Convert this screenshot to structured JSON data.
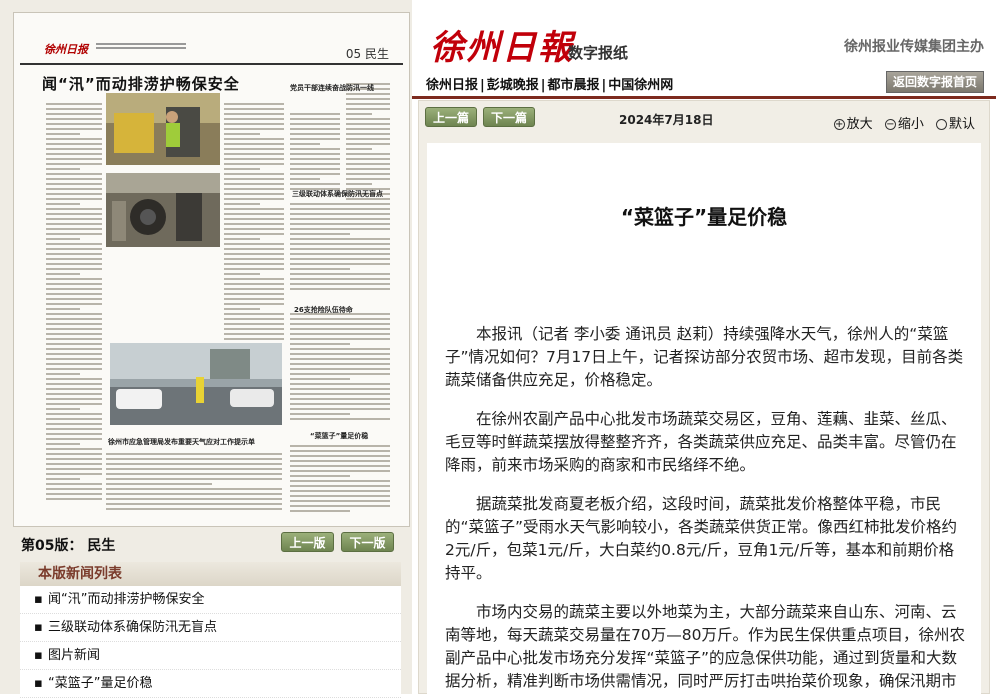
{
  "colors": {
    "brand_red": "#c1000a",
    "nav_rule": "#7d2a1e",
    "button_green": "#7a9158",
    "list_header_text": "#7a3b2b",
    "panel_bg": "#f1eee6"
  },
  "thumbnail": {
    "logo": "徐州日报",
    "page_label": "05 民生",
    "headline": "闻“汛”而动排涝护畅保安全",
    "heads": [
      "党员干部连续奋战防汛一线",
      "三级联动体系确保防汛无盲点",
      "26支抢险队伍待命",
      "徐州市应急管理局发布重要天气应对工作提示单",
      "“菜篮子”量足价稳"
    ]
  },
  "edition": {
    "label": "第05版： 民生",
    "prev_button": "上一版",
    "next_button": "下一版"
  },
  "news_list": {
    "header": "本版新闻列表",
    "bullet": "▪",
    "items": [
      "闻“汛”而动排涝护畅保安全",
      "三级联动体系确保防汛无盲点",
      "图片新闻",
      "“菜篮子”量足价稳"
    ]
  },
  "header": {
    "logo": "徐州日報",
    "logo_sub": "数字报纸",
    "sponsor": "徐州报业传媒集团主办"
  },
  "nav": {
    "links": [
      "徐州日报",
      "彭城晚报",
      "都市晨报",
      "中国徐州网"
    ],
    "separator": "|",
    "home_button": "返回数字报首页"
  },
  "toolbar": {
    "prev_article": "上一篇",
    "next_article": "下一篇",
    "date": "2024年7月18日",
    "zoom_in": "放大",
    "zoom_out": "缩小",
    "default": "默认"
  },
  "article": {
    "title": "“菜篮子”量足价稳",
    "paragraphs": [
      "本报讯（记者 李小委 通讯员 赵莉）持续强降水天气，徐州人的“菜篮子”情况如何？7月17日上午，记者探访部分农贸市场、超市发现，目前各类蔬菜储备供应充足，价格稳定。",
      "在徐州农副产品中心批发市场蔬菜交易区，豆角、莲藕、韭菜、丝瓜、毛豆等时鲜蔬菜摆放得整整齐齐，各类蔬菜供应充足、品类丰富。尽管仍在降雨，前来市场采购的商家和市民络绎不绝。",
      "据蔬菜批发商夏老板介绍，这段时间，蔬菜批发价格整体平稳，市民的“菜篮子”受雨水天气影响较小，各类蔬菜供货正常。像西红柿批发价格约2元/斤，包菜1元/斤，大白菜约0.8元/斤，豆角1元/斤等，基本和前期价格持平。",
      "市场内交易的蔬菜主要以外地菜为主，大部分蔬菜来自山东、河南、云南等地，每天蔬菜交易量在70万—80万斤。作为民生保供重点项目，徐州农副产品中心批发市场充分发挥“菜篮子”的应急保供功能，通过到货量和大数据分析，精准判断市场供需情况，同时严厉打击哄抬菜价现象，确保汛期市民“菜篮子”拎得稳。"
    ]
  }
}
